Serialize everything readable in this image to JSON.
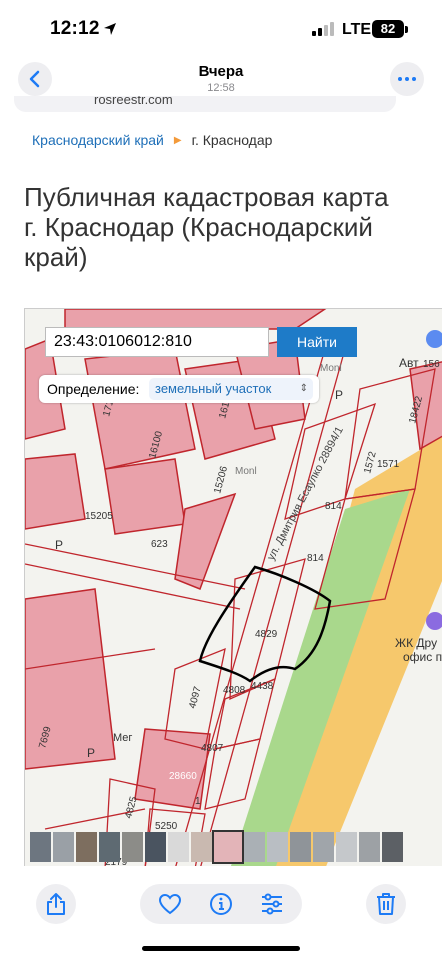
{
  "status_bar": {
    "time": "12:12",
    "network": "LTE",
    "battery": "82"
  },
  "viewer_header": {
    "title": "Вчера",
    "subtitle": "12:58"
  },
  "browser": {
    "url_fragment": "rosreestr.com"
  },
  "breadcrumb": {
    "region": "Краснодарский край",
    "city": "г. Краснодар"
  },
  "page": {
    "title_line1": "Публичная кадастровая карта",
    "title_line2": "г. Краснодар (Краснодарский",
    "title_line3": "край)"
  },
  "map_search": {
    "query": "23:43:0106012:810",
    "button": "Найти",
    "definition_label": "Определение:",
    "definition_value": "земельный участок"
  },
  "map_labels": {
    "street": "ул. Дмитрия Есаулко 28894/1",
    "parcels": [
      "17112",
      "16100",
      "16173",
      "1572",
      "1571",
      "15206",
      "15205",
      "623",
      "814",
      "814",
      "4829",
      "4438",
      "4097",
      "4808",
      "4807",
      "28660",
      "4825",
      "5250",
      "7699",
      "2179",
      "18422",
      "156",
      "1"
    ],
    "poi_1": "Авт",
    "poi_2": "ЖК Дру",
    "poi_3": "офис пр",
    "poi_4": "Мег",
    "poi_5": "Monl",
    "poi_6": "Monl",
    "letter_p": "Р"
  },
  "icons": {
    "back": "chevron-left-icon",
    "more": "ellipsis-icon",
    "share": "share-icon",
    "favorite": "heart-icon",
    "info": "info-icon",
    "adjust": "sliders-icon",
    "delete": "trash-icon"
  },
  "colors": {
    "accent": "#1e7bc8",
    "parcel_fill": "#e9a1aa",
    "parcel_line": "#c0262d",
    "road": "#f5c66b"
  }
}
